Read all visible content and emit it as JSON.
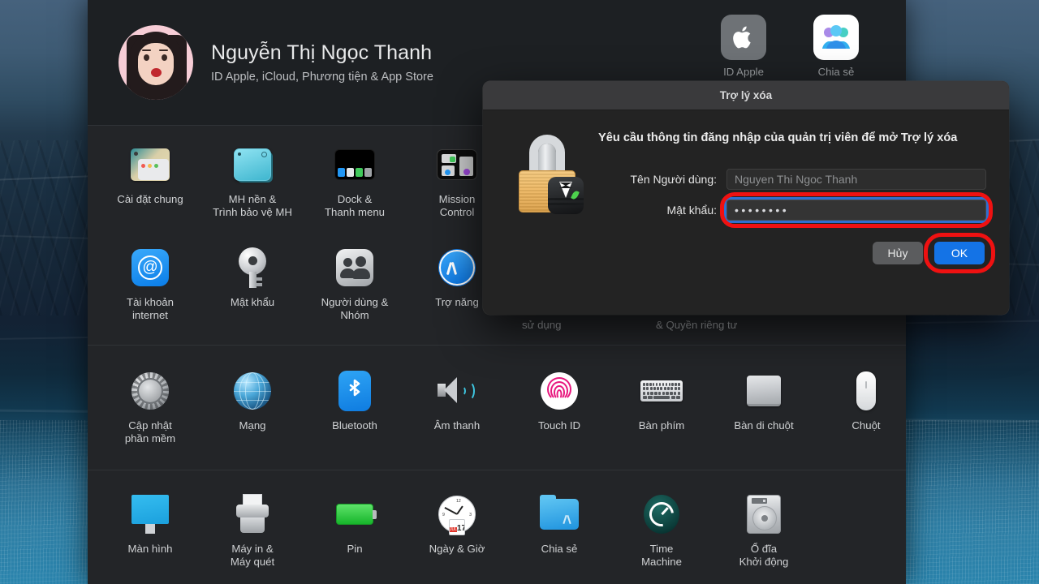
{
  "desktop": {
    "wallpaper_name": "big-sur-coastline"
  },
  "system_preferences": {
    "user": {
      "name": "Nguyễn Thị Ngọc Thanh",
      "subtitle": "ID Apple, iCloud, Phương tiện & App Store",
      "avatar": "memoji-avatar"
    },
    "occluded_top_items": [
      {
        "label": "ID Apple",
        "icon": "apple-logo-icon"
      },
      {
        "label": "Chia sẻ",
        "icon": "family-sharing-icon"
      }
    ],
    "occluded_clipped_labels": [
      "sử dụng",
      "& Quyền riêng tư"
    ],
    "rows": [
      {
        "name": "row-personal",
        "items": [
          {
            "label": "Cài đặt chung",
            "icon": "general-icon"
          },
          {
            "label": "MH nền &\nTrình bảo vệ MH",
            "icon": "desktop-screensaver-icon"
          },
          {
            "label": "Dock &\nThanh menu",
            "icon": "dock-menubar-icon"
          },
          {
            "label": "Mission\nControl",
            "icon": "mission-control-icon"
          }
        ]
      },
      {
        "name": "row-accounts",
        "items": [
          {
            "label": "Tài khoản\ninternet",
            "icon": "internet-accounts-icon"
          },
          {
            "label": "Mật khẩu",
            "icon": "passwords-key-icon"
          },
          {
            "label": "Người dùng &\nNhóm",
            "icon": "users-groups-icon"
          },
          {
            "label": "Trợ năng",
            "icon": "accessibility-icon"
          }
        ]
      },
      {
        "name": "row-hardware",
        "items": [
          {
            "label": "Cập nhật\nphần mềm",
            "icon": "software-update-icon"
          },
          {
            "label": "Mạng",
            "icon": "network-globe-icon"
          },
          {
            "label": "Bluetooth",
            "icon": "bluetooth-icon"
          },
          {
            "label": "Âm thanh",
            "icon": "sound-speaker-icon"
          },
          {
            "label": "Touch ID",
            "icon": "touch-id-fingerprint-icon"
          },
          {
            "label": "Bàn phím",
            "icon": "keyboard-icon"
          },
          {
            "label": "Bàn di chuột",
            "icon": "trackpad-icon"
          },
          {
            "label": "Chuột",
            "icon": "mouse-icon"
          }
        ]
      },
      {
        "name": "row-system",
        "items": [
          {
            "label": "Màn hình",
            "icon": "display-icon"
          },
          {
            "label": "Máy in &\nMáy quét",
            "icon": "printers-scanners-icon"
          },
          {
            "label": "Pin",
            "icon": "battery-icon"
          },
          {
            "label": "Ngày & Giờ",
            "icon": "date-time-clock-icon"
          },
          {
            "label": "Chia sẻ",
            "icon": "sharing-folder-icon"
          },
          {
            "label": "Time\nMachine",
            "icon": "time-machine-icon"
          },
          {
            "label": "Ổ đĩa\nKhởi động",
            "icon": "startup-disk-icon"
          }
        ]
      }
    ]
  },
  "dialog": {
    "title": "Trợ lý xóa",
    "icon": "lock-with-tuxedo-icon",
    "message": "Yêu cầu thông tin đăng nhập của quản trị viên để mở Trợ lý xóa",
    "username_label": "Tên Người dùng:",
    "username_value": "Nguyen Thi Ngoc Thanh",
    "password_label": "Mật khẩu:",
    "password_value": "••••••••",
    "cancel_label": "Hủy",
    "ok_label": "OK",
    "accent_color": "#1473e6",
    "annotation_color": "#ef1111"
  }
}
